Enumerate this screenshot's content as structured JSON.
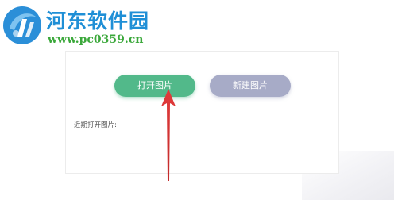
{
  "watermark": {
    "title": "河东软件园",
    "url": "www.pc0359.cn",
    "logo_icon": "hedong-logo-icon",
    "title_color": "#1f8fd6",
    "url_color": "#3ba83b"
  },
  "dialog": {
    "open_image_button": "打开图片",
    "new_image_button": "新建图片",
    "recent_images_label": "近期打开图片:",
    "open_button_color": "#52b98a",
    "new_button_color": "#a7abc7"
  },
  "annotation": {
    "arrow_icon": "red-arrow-up-icon",
    "arrow_color": "#d63a3a"
  }
}
